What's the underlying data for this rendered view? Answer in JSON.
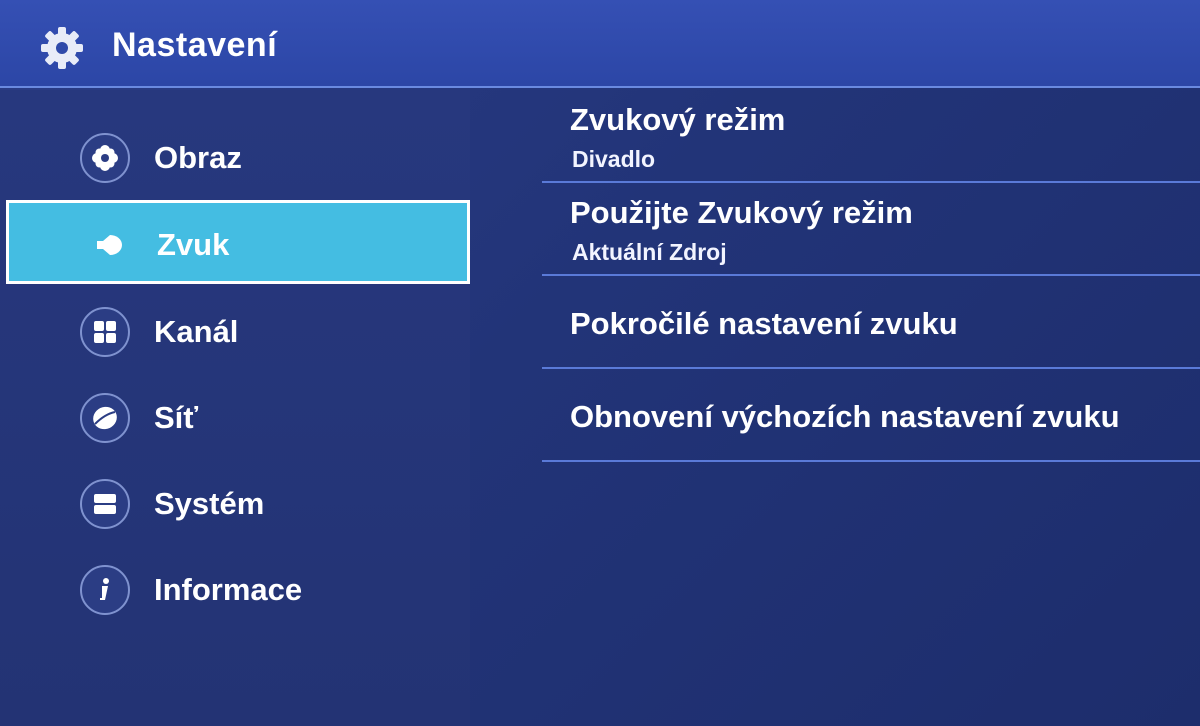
{
  "header": {
    "title": "Nastavení",
    "icon": "gear-icon"
  },
  "sidebar": {
    "items": [
      {
        "label": "Obraz",
        "icon": "flower-icon",
        "selected": false
      },
      {
        "label": "Zvuk",
        "icon": "speaker-icon",
        "selected": true
      },
      {
        "label": "Kanál",
        "icon": "grid-icon",
        "selected": false
      },
      {
        "label": "Síť",
        "icon": "globe-icon",
        "selected": false
      },
      {
        "label": "Systém",
        "icon": "panel-icon",
        "selected": false
      },
      {
        "label": "Informace",
        "icon": "info-icon",
        "selected": false
      }
    ]
  },
  "content": {
    "rows": [
      {
        "title": "Zvukový režim",
        "value": "Divadlo"
      },
      {
        "title": "Použijte Zvukový režim",
        "value": "Aktuální Zdroj"
      },
      {
        "title": "Pokročilé nastavení zvuku"
      },
      {
        "title": "Obnovení výchozích nastavení zvuku"
      }
    ]
  },
  "colors": {
    "background": "#223478",
    "header": "#3550b4",
    "selected": "#44bde2",
    "divider": "#5a7ad8",
    "text": "#ffffff"
  }
}
